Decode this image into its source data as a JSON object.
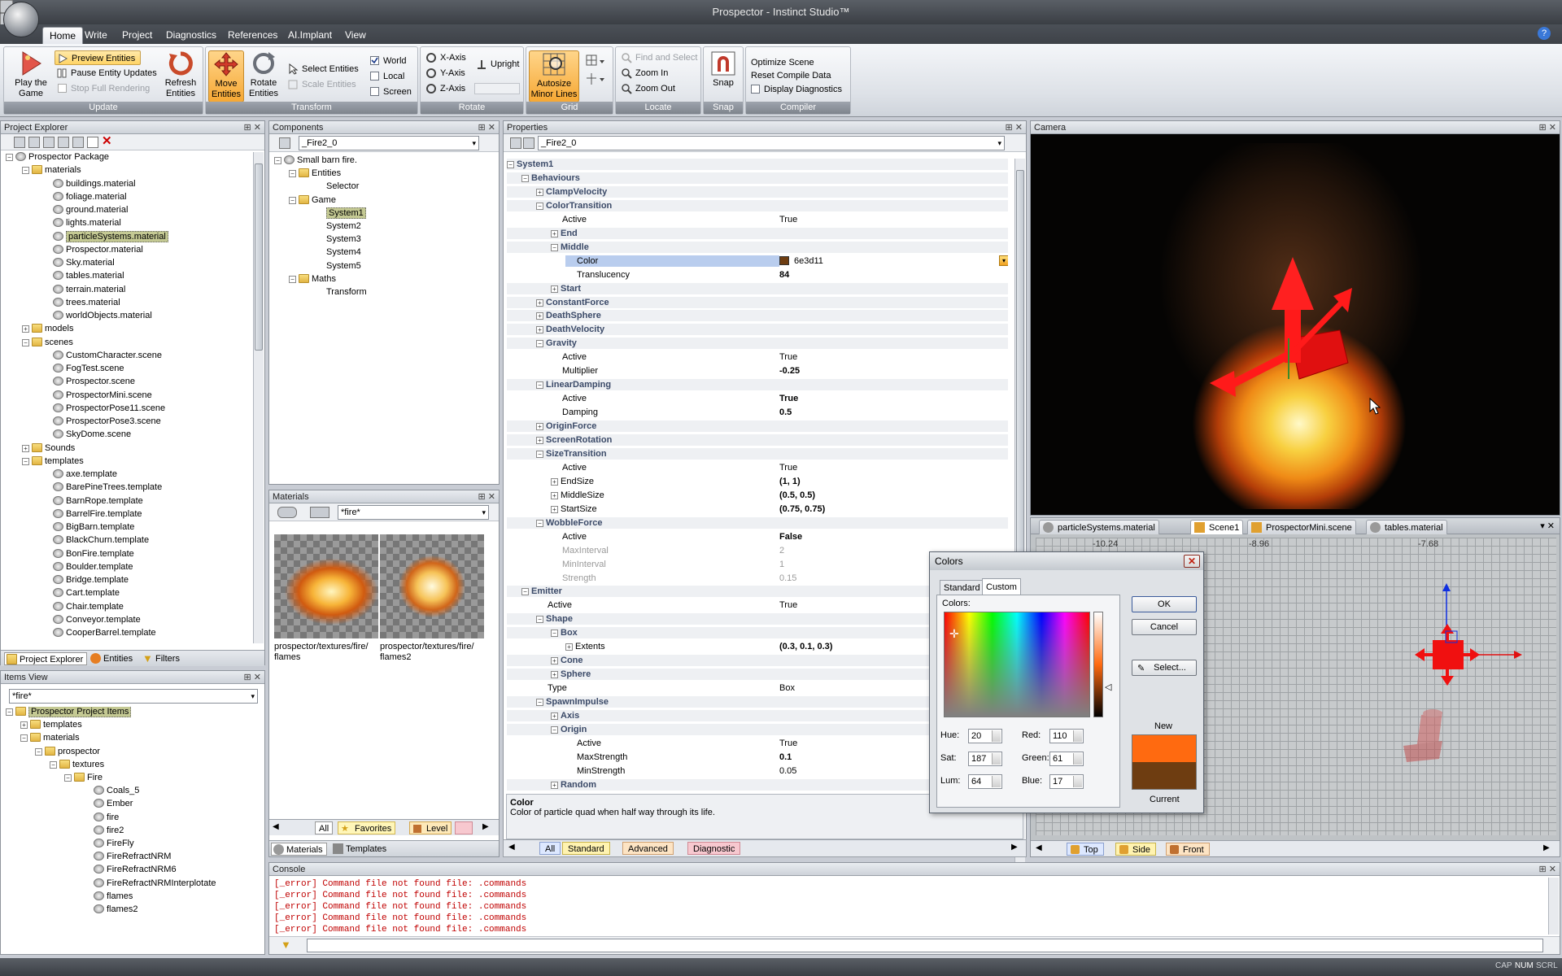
{
  "window": {
    "title": "Prospector - Instinct Studio™"
  },
  "ribbon_tabs": [
    "Home",
    "Write",
    "Project",
    "Diagnostics",
    "References",
    "AI.Implant",
    "View"
  ],
  "ribbon": {
    "update": {
      "label": "Update",
      "play": "Play the Game",
      "preview": "Preview Entities",
      "pause": "Pause Entity Updates",
      "stop": "Stop Full Rendering",
      "refresh": "Refresh Entities"
    },
    "transform": {
      "label": "Transform",
      "move": "Move Entities",
      "rotate": "Rotate Entities",
      "select": "Select Entities",
      "scale": "Scale Entities",
      "world": "World",
      "local": "Local",
      "screen": "Screen"
    },
    "rotate": {
      "label": "Rotate",
      "x": "X-Axis",
      "y": "Y-Axis",
      "z": "Z-Axis",
      "upright": "Upright"
    },
    "grid": {
      "label": "Grid",
      "autosize": "Autosize Minor Lines"
    },
    "locate": {
      "label": "Locate",
      "find": "Find and Select",
      "zoom_in": "Zoom In",
      "zoom_out": "Zoom Out"
    },
    "snap": {
      "label": "Snap",
      "snap": "Snap"
    },
    "compiler": {
      "label": "Compiler",
      "optimize": "Optimize Scene",
      "reset": "Reset Compile Data",
      "display": "Display Diagnostics"
    }
  },
  "project_explorer": {
    "title": "Project Explorer",
    "root": "Prospector Package",
    "materials_folder": "materials",
    "materials": [
      "buildings.material",
      "foliage.material",
      "ground.material",
      "lights.material",
      "particleSystems.material",
      "Prospector.material",
      "Sky.material",
      "tables.material",
      "terrain.material",
      "trees.material",
      "worldObjects.material"
    ],
    "models_folder": "models",
    "scenes_folder": "scenes",
    "scenes": [
      "CustomCharacter.scene",
      "FogTest.scene",
      "Prospector.scene",
      "ProspectorMini.scene",
      "ProspectorPose11.scene",
      "ProspectorPose3.scene",
      "SkyDome.scene"
    ],
    "sounds_folder": "Sounds",
    "templates_folder": "templates",
    "templates": [
      "axe.template",
      "BarePineTrees.template",
      "BarnRope.template",
      "BarrelFire.template",
      "BigBarn.template",
      "BlackChurn.template",
      "BonFire.template",
      "Boulder.template",
      "Bridge.template",
      "Cart.template",
      "Chair.template",
      "Conveyor.template",
      "CooperBarrel.template"
    ],
    "tabs": [
      "Project Explorer",
      "Entities",
      "Filters"
    ]
  },
  "items_view": {
    "title": "Items View",
    "filter": "*fire*",
    "root": "Prospector Project Items",
    "nodes": [
      "templates",
      "materials",
      "prospector",
      "textures",
      "Fire"
    ],
    "items": [
      "Coals_5",
      "Ember",
      "fire",
      "fire2",
      "FireFly",
      "FireRefractNRM",
      "FireRefractNRM6",
      "FireRefractNRMInterplotate",
      "flames",
      "flames2"
    ]
  },
  "components": {
    "title": "Components",
    "selector": "_Fire2_0",
    "root": "Small barn fire.",
    "entities": "Entities",
    "selector_item": "Selector",
    "game": "Game",
    "systems": [
      "System1",
      "System2",
      "System3",
      "System4",
      "System5"
    ],
    "maths": "Maths",
    "transform": "Transform"
  },
  "materials_panel": {
    "title": "Materials",
    "filter": "*fire*",
    "items": [
      {
        "label1": "prospector/textures/fire/",
        "label2": "flames"
      },
      {
        "label1": "prospector/textures/fire/",
        "label2": "flames2"
      }
    ],
    "tabs": [
      "All",
      "Favorites",
      "Level"
    ],
    "bottom_tabs": [
      "Materials",
      "Templates"
    ]
  },
  "properties": {
    "title": "Properties",
    "selector": "_Fire2_0",
    "rows": [
      {
        "n": "System1",
        "v": "",
        "d": 0,
        "t": "cat",
        "e": "-"
      },
      {
        "n": "Behaviours",
        "v": "",
        "d": 1,
        "t": "cat",
        "e": "-"
      },
      {
        "n": "ClampVelocity",
        "v": "",
        "d": 2,
        "t": "cat",
        "e": "+"
      },
      {
        "n": "ColorTransition",
        "v": "",
        "d": 2,
        "t": "cat",
        "e": "-"
      },
      {
        "n": "Active",
        "v": "True",
        "d": 3,
        "t": "",
        "e": ""
      },
      {
        "n": "End",
        "v": "",
        "d": 3,
        "t": "cat",
        "e": "+"
      },
      {
        "n": "Middle",
        "v": "",
        "d": 3,
        "t": "cat",
        "e": "-"
      },
      {
        "n": "Color",
        "v": "6e3d11",
        "d": 4,
        "t": "sel",
        "e": ""
      },
      {
        "n": "Translucency",
        "v": "84",
        "d": 4,
        "t": "b",
        "e": ""
      },
      {
        "n": "Start",
        "v": "",
        "d": 3,
        "t": "cat",
        "e": "+"
      },
      {
        "n": "ConstantForce",
        "v": "",
        "d": 2,
        "t": "cat",
        "e": "+"
      },
      {
        "n": "DeathSphere",
        "v": "",
        "d": 2,
        "t": "cat",
        "e": "+"
      },
      {
        "n": "DeathVelocity",
        "v": "",
        "d": 2,
        "t": "cat",
        "e": "+"
      },
      {
        "n": "Gravity",
        "v": "",
        "d": 2,
        "t": "cat",
        "e": "-"
      },
      {
        "n": "Active",
        "v": "True",
        "d": 3,
        "t": "",
        "e": ""
      },
      {
        "n": "Multiplier",
        "v": "-0.25",
        "d": 3,
        "t": "b",
        "e": ""
      },
      {
        "n": "LinearDamping",
        "v": "",
        "d": 2,
        "t": "cat",
        "e": "-"
      },
      {
        "n": "Active",
        "v": "True",
        "d": 3,
        "t": "b",
        "e": ""
      },
      {
        "n": "Damping",
        "v": "0.5",
        "d": 3,
        "t": "b",
        "e": ""
      },
      {
        "n": "OriginForce",
        "v": "",
        "d": 2,
        "t": "cat",
        "e": "+"
      },
      {
        "n": "ScreenRotation",
        "v": "",
        "d": 2,
        "t": "cat",
        "e": "+"
      },
      {
        "n": "SizeTransition",
        "v": "",
        "d": 2,
        "t": "cat",
        "e": "-"
      },
      {
        "n": "Active",
        "v": "True",
        "d": 3,
        "t": "",
        "e": ""
      },
      {
        "n": "EndSize",
        "v": "(1, 1)",
        "d": 3,
        "t": "b",
        "e": "+"
      },
      {
        "n": "MiddleSize",
        "v": "(0.5, 0.5)",
        "d": 3,
        "t": "b",
        "e": "+"
      },
      {
        "n": "StartSize",
        "v": "(0.75, 0.75)",
        "d": 3,
        "t": "b",
        "e": "+"
      },
      {
        "n": "WobbleForce",
        "v": "",
        "d": 2,
        "t": "cat",
        "e": "-"
      },
      {
        "n": "Active",
        "v": "False",
        "d": 3,
        "t": "b",
        "e": ""
      },
      {
        "n": "MaxInterval",
        "v": "2",
        "d": 3,
        "t": "g",
        "e": ""
      },
      {
        "n": "MinInterval",
        "v": "1",
        "d": 3,
        "t": "g",
        "e": ""
      },
      {
        "n": "Strength",
        "v": "0.15",
        "d": 3,
        "t": "g",
        "e": ""
      },
      {
        "n": "Emitter",
        "v": "",
        "d": 1,
        "t": "cat",
        "e": "-"
      },
      {
        "n": "Active",
        "v": "True",
        "d": 2,
        "t": "",
        "e": ""
      },
      {
        "n": "Shape",
        "v": "",
        "d": 2,
        "t": "cat",
        "e": "-"
      },
      {
        "n": "Box",
        "v": "",
        "d": 3,
        "t": "cat",
        "e": "-"
      },
      {
        "n": "Extents",
        "v": "(0.3, 0.1, 0.3)",
        "d": 4,
        "t": "b",
        "e": "+"
      },
      {
        "n": "Cone",
        "v": "",
        "d": 3,
        "t": "cat",
        "e": "+"
      },
      {
        "n": "Sphere",
        "v": "",
        "d": 3,
        "t": "cat",
        "e": "+"
      },
      {
        "n": "Type",
        "v": "Box",
        "d": 2,
        "t": "",
        "e": ""
      },
      {
        "n": "SpawnImpulse",
        "v": "",
        "d": 2,
        "t": "cat",
        "e": "-"
      },
      {
        "n": "Axis",
        "v": "",
        "d": 3,
        "t": "cat",
        "e": "+"
      },
      {
        "n": "Origin",
        "v": "",
        "d": 3,
        "t": "cat",
        "e": "-"
      },
      {
        "n": "Active",
        "v": "True",
        "d": 4,
        "t": "",
        "e": ""
      },
      {
        "n": "MaxStrength",
        "v": "0.1",
        "d": 4,
        "t": "b",
        "e": ""
      },
      {
        "n": "MinStrength",
        "v": "0.05",
        "d": 4,
        "t": "",
        "e": ""
      },
      {
        "n": "Random",
        "v": "",
        "d": 3,
        "t": "cat",
        "e": "+"
      }
    ],
    "desc_title": "Color",
    "desc_text": "Color of particle quad when half way through its life.",
    "tabs": [
      "All",
      "Standard",
      "Advanced",
      "Diagnostic"
    ],
    "color_swatch": "#6e3d11"
  },
  "camera": {
    "title": "Camera"
  },
  "scene": {
    "tabs": [
      "particleSystems.material",
      "Scene1",
      "ProspectorMini.scene",
      "tables.material"
    ],
    "ruler": [
      "-10.24",
      "-8.96",
      "-7.68"
    ],
    "views": [
      "Top",
      "Side",
      "Front"
    ]
  },
  "colors_dialog": {
    "title": "Colors",
    "tabs": [
      "Standard",
      "Custom"
    ],
    "colors_label": "Colors:",
    "ok": "OK",
    "cancel": "Cancel",
    "select": "Select...",
    "hue_label": "Hue:",
    "hue": "20",
    "sat_label": "Sat:",
    "sat": "187",
    "lum_label": "Lum:",
    "lum": "64",
    "red_label": "Red:",
    "red": "110",
    "green_label": "Green:",
    "green": "61",
    "blue_label": "Blue:",
    "blue": "17",
    "new_label": "New",
    "current_label": "Current",
    "new_color": "#ff6a10",
    "current_color": "#6e3d11"
  },
  "console": {
    "title": "Console",
    "lines": [
      "[_error] Command file not found file: .commands",
      "[_error] Command file not found file: .commands",
      "[_error] Command file not found file: .commands",
      "[_error] Command file not found file: .commands",
      "[_error] Command file not found file: .commands"
    ]
  },
  "status": {
    "cap": "CAP",
    "num": "NUM",
    "scrl": "SCRL"
  }
}
